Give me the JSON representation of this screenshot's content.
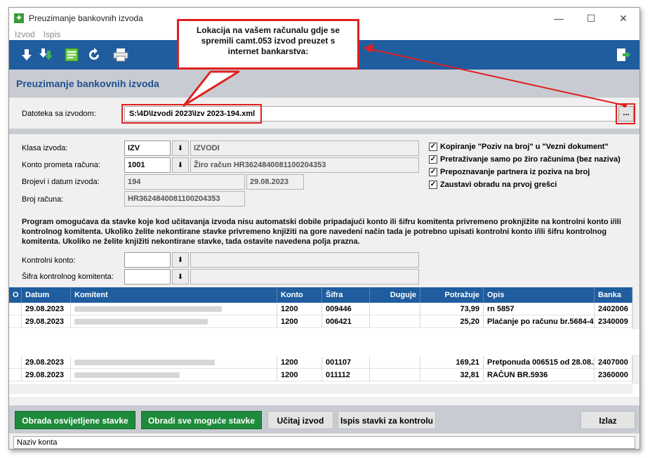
{
  "window": {
    "title": "Preuzimanje bankovnih izvoda"
  },
  "menu": [
    "Izvod",
    "Ispis"
  ],
  "header": {
    "title": "Preuzimanje bankovnih izvoda"
  },
  "file": {
    "label": "Datoteka sa izvodom:",
    "value": "S:\\4D\\Izvodi 2023\\Izv 2023-194.xml",
    "browse_label": "..."
  },
  "callout": {
    "text": "Lokacija na vašem računalu gdje se spremili camt.053 izvod preuzet s internet bankarstva:"
  },
  "form": {
    "klasa_label": "Klasa izvoda:",
    "klasa_code": "IZV",
    "klasa_name": "IZVODI",
    "konto_label": "Konto prometa računa:",
    "konto_code": "1001",
    "konto_name": "Žiro račun HR3624840081100204353",
    "brojevi_label": "Brojevi i datum izvoda:",
    "broj_izvoda": "194",
    "datum_izvoda": "29.08.2023",
    "broj_racuna_label": "Broj računa:",
    "broj_racuna": "HR3624840081100204353",
    "info": "Program omogućava da stavke koje kod učitavanja izvoda nisu automatski dobile pripadajući konto ili šifru komitenta privremeno proknjižite na kontrolni konto i/ili kontrolnog komitenta. Ukoliko želite nekontirane stavke privremeno knjižiti na gore navedeni način tada je potrebno upisati kontrolni konto i/ili šifru kontrolnog komitenta. Ukoliko ne želite knjižiti nekontirane stavke, tada ostavite navedena polja prazna.",
    "kontrolni_konto_label": "Kontrolni konto:",
    "sifra_komitenta_label": "Šifra kontrolnog komitenta:"
  },
  "options": [
    {
      "label": "Kopiranje \"Poziv na broj\" u \"Vezni dokument\"",
      "checked": true
    },
    {
      "label": "Pretraživanje samo po žiro računima (bez naziva)",
      "checked": true
    },
    {
      "label": "Prepoznavanje partnera iz poziva na broj",
      "checked": true
    },
    {
      "label": "Zaustavi obradu na prvoj grešci",
      "checked": true
    }
  ],
  "grid": {
    "columns": [
      "O",
      "Datum",
      "Komitent",
      "Konto",
      "Šifra",
      "Duguje",
      "Potražuje",
      "Opis",
      "Banka"
    ],
    "rows_top": [
      {
        "datum": "29.08.2023",
        "konto": "1200",
        "sifra": "009446",
        "duguje": "",
        "potrazuje": "73,99",
        "opis": "rn 5857",
        "banka": "2402006"
      },
      {
        "datum": "29.08.2023",
        "konto": "1200",
        "sifra": "006421",
        "duguje": "",
        "potrazuje": "25,20",
        "opis": "Plaćanje po računu br.5684-4",
        "banka": "2340009"
      }
    ],
    "rows_bottom": [
      {
        "datum": "29.08.2023",
        "konto": "1200",
        "sifra": "001107",
        "duguje": "",
        "potrazuje": "169,21",
        "opis": "Pretponuda 006515 od 28.08.2",
        "banka": "2407000"
      },
      {
        "datum": "29.08.2023",
        "konto": "1200",
        "sifra": "011112",
        "duguje": "",
        "potrazuje": "32,81",
        "opis": "RAČUN BR.5936",
        "banka": "2360000"
      }
    ]
  },
  "buttons": {
    "obrada_osvijetljene": "Obrada osvijetljene stavke",
    "obradi_sve": "Obradi sve moguće stavke",
    "ucitaj": "Učitaj izvod",
    "ispis_stavki": "Ispis stavki za kontrolu",
    "izlaz": "Izlaz"
  },
  "status": {
    "text": "Naziv konta"
  },
  "colors": {
    "toolbar": "#1f5d9f",
    "green": "#1e8a3c",
    "callout_red": "#e02020"
  }
}
